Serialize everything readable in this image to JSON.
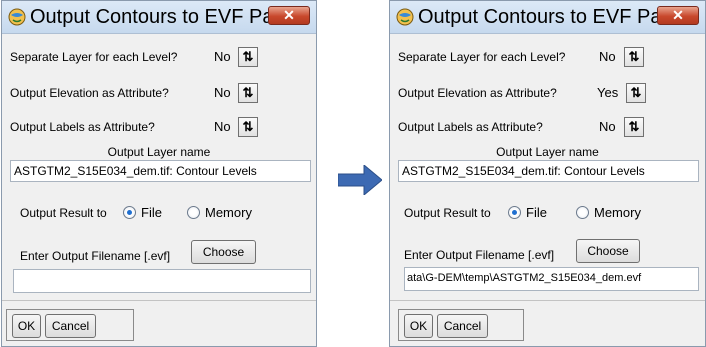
{
  "colors": {
    "arrow": "#3d6ab3",
    "radio_selected": "#1f6fd0",
    "close_button": "#c8482c"
  },
  "icons": {
    "title_icon": "globe-icon",
    "sort_icon": "sort-arrows-icon",
    "close_icon": "close-icon",
    "arrow": "right-arrow-icon"
  },
  "dialogs": [
    {
      "title": "Output Contours to EVF Par...",
      "close_label": "✕",
      "separate_layer": {
        "label": "Separate Layer for each Level?",
        "value": "No",
        "sort": "⇅"
      },
      "output_elevation": {
        "label": "Output Elevation as Attribute?",
        "value": "No",
        "sort": "⇅"
      },
      "output_labels": {
        "label": "Output Labels as Attribute?",
        "value": "No",
        "sort": "⇅"
      },
      "layer_name": {
        "label": "Output Layer name",
        "value": "ASTGTM2_S15E034_dem.tif: Contour Levels"
      },
      "output_result": {
        "label": "Output Result to",
        "options": [
          "File",
          "Memory"
        ],
        "selected": "File"
      },
      "filename": {
        "label": "Enter Output Filename [.evf]",
        "choose_label": "Choose",
        "value": ""
      },
      "ok_label": "OK",
      "cancel_label": "Cancel"
    },
    {
      "title": "Output Contours to EVF Par...",
      "close_label": "✕",
      "separate_layer": {
        "label": "Separate Layer for each Level?",
        "value": "No",
        "sort": "⇅"
      },
      "output_elevation": {
        "label": "Output Elevation as Attribute?",
        "value": "Yes",
        "sort": "⇅"
      },
      "output_labels": {
        "label": "Output Labels as Attribute?",
        "value": "No",
        "sort": "⇅"
      },
      "layer_name": {
        "label": "Output Layer name",
        "value": "ASTGTM2_S15E034_dem.tif: Contour Levels"
      },
      "output_result": {
        "label": "Output Result to",
        "options": [
          "File",
          "Memory"
        ],
        "selected": "File"
      },
      "filename": {
        "label": "Enter Output Filename [.evf]",
        "choose_label": "Choose",
        "value": "ata\\G-DEM\\temp\\ASTGTM2_S15E034_dem.evf"
      },
      "ok_label": "OK",
      "cancel_label": "Cancel"
    }
  ]
}
